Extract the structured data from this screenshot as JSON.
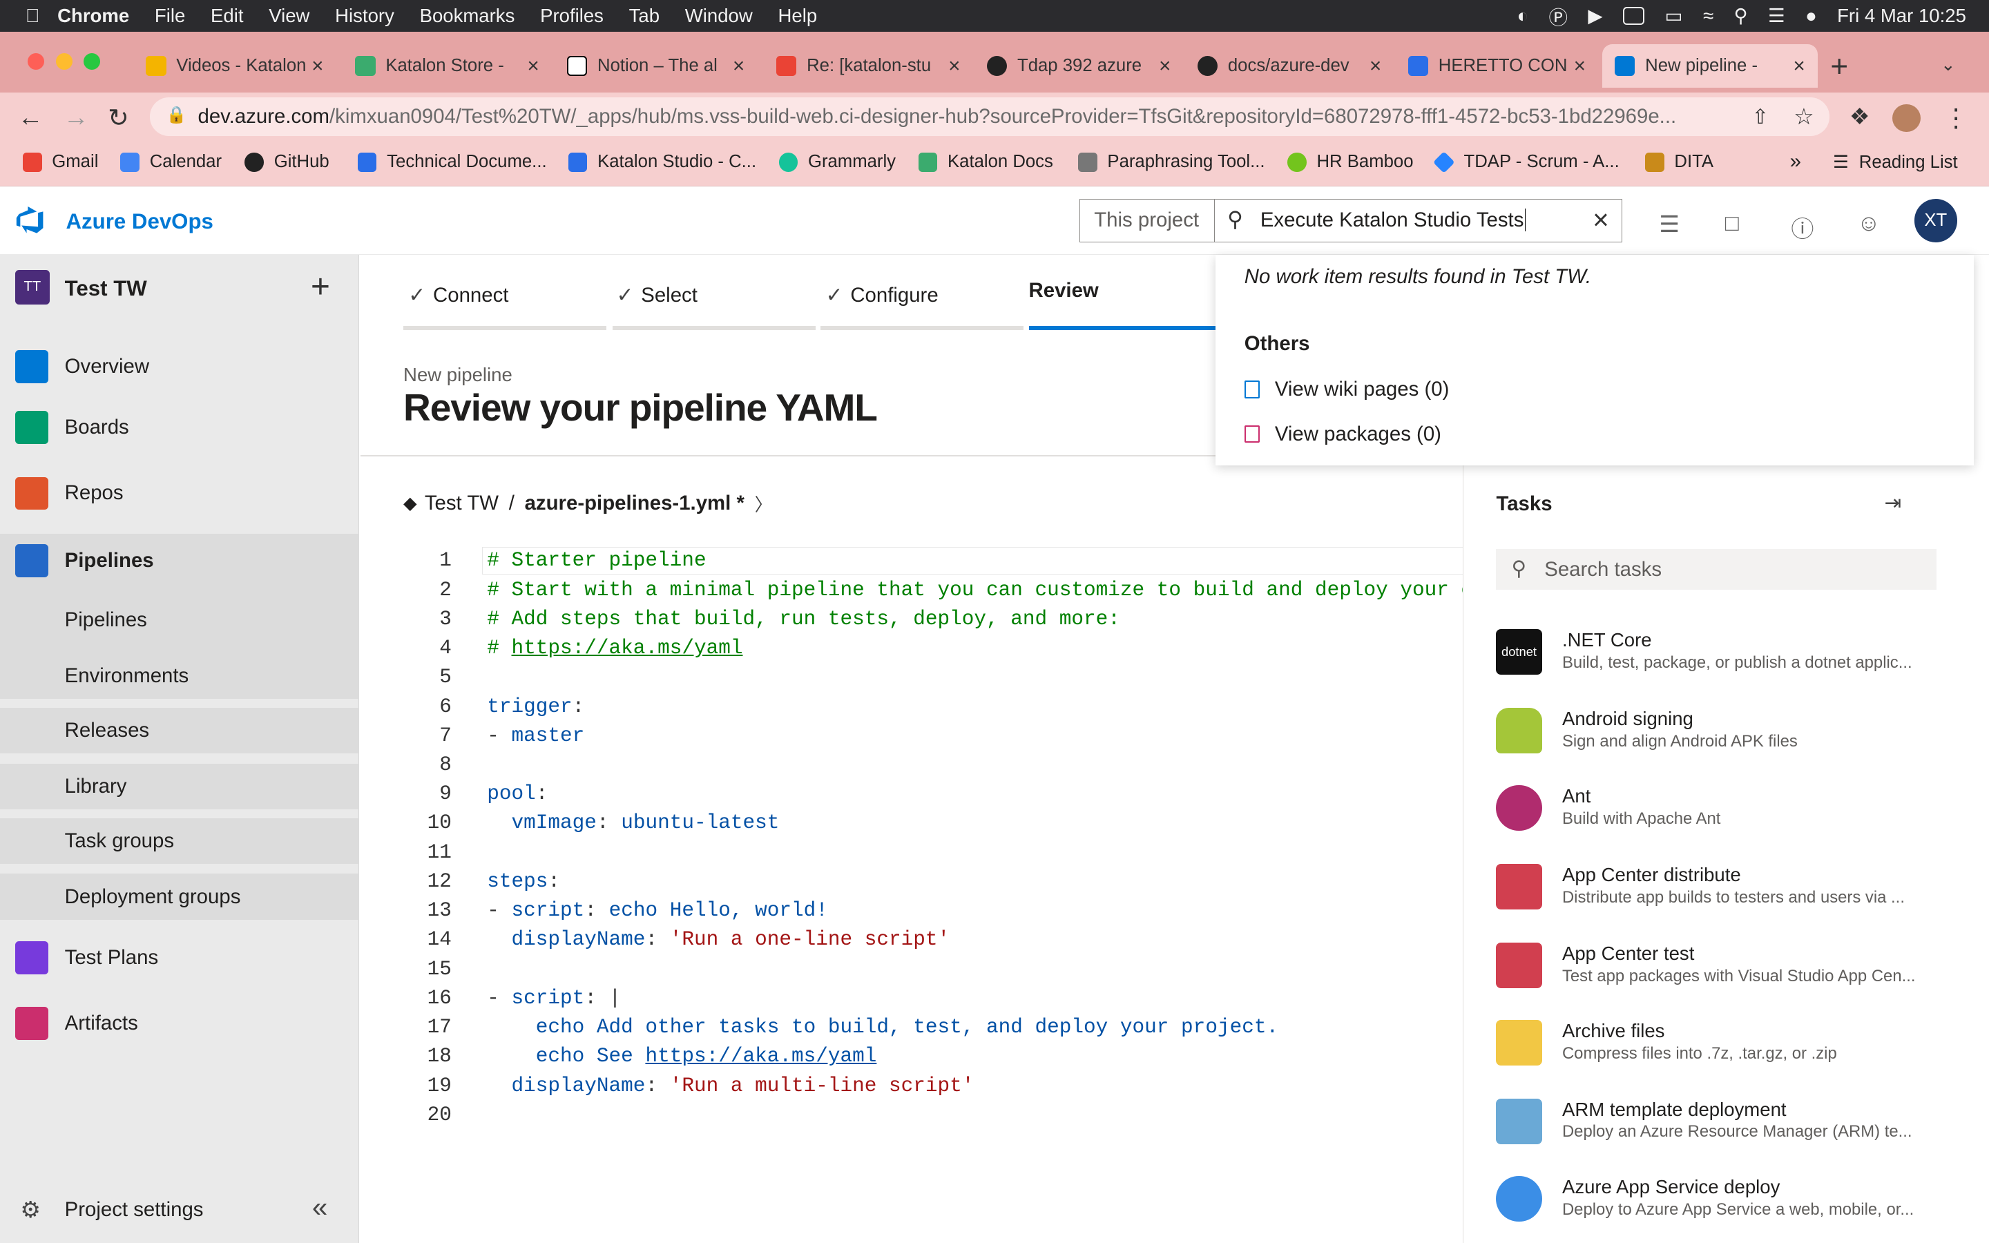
{
  "mac_menu": {
    "app": "Chrome",
    "items": [
      "File",
      "Edit",
      "View",
      "History",
      "Bookmarks",
      "Profiles",
      "Tab",
      "Window",
      "Help"
    ],
    "clock": "Fri 4 Mar  10:25"
  },
  "browser": {
    "tabs": [
      "Videos - Katalon",
      "Katalon Store -",
      "Notion – The al",
      "Re: [katalon-stu",
      "Tdap 392 azure",
      "docs/azure-dev",
      "HERETTO CON",
      "New pipeline - "
    ],
    "url_host": "dev.azure.com",
    "url_path": "/kimxuan0904/Test%20TW/_apps/hub/ms.vss-build-web.ci-designer-hub?sourceProvider=TfsGit&repositoryId=68072978-fff1-4572-bc53-1bd22969e...",
    "bookmarks": [
      "Gmail",
      "Calendar",
      "GitHub",
      "Technical Docume...",
      "Katalon Studio - C...",
      "Grammarly",
      "Katalon Docs",
      "Paraphrasing Tool...",
      "HR Bamboo",
      "TDAP - Scrum - A...",
      "DITA"
    ],
    "reading_list": "Reading List"
  },
  "header": {
    "brand": "Azure DevOps",
    "scope": "This project",
    "search_value": "Execute Katalon Studio Tests",
    "avatar": "XT"
  },
  "sidebar": {
    "project_initials": "TT",
    "project_name": "Test TW",
    "items": [
      "Overview",
      "Boards",
      "Repos",
      "Pipelines",
      "Pipelines",
      "Environments",
      "Releases",
      "Library",
      "Task groups",
      "Deployment groups",
      "Test Plans",
      "Artifacts"
    ],
    "settings": "Project settings"
  },
  "wizard": {
    "steps": [
      "Connect",
      "Select",
      "Configure",
      "Review"
    ],
    "subtitle": "New pipeline",
    "title": "Review your pipeline YAML"
  },
  "breadcrumb": {
    "repo": "Test TW",
    "sep": "/",
    "file": "azure-pipelines-1.yml *"
  },
  "editor": {
    "line_numbers": [
      "1",
      "2",
      "3",
      "4",
      "5",
      "6",
      "7",
      "8",
      "9",
      "10",
      "11",
      "12",
      "13",
      "14",
      "15",
      "16",
      "17",
      "18",
      "19",
      "20"
    ]
  },
  "search_dropdown": {
    "no_results": "No work item results found in Test TW.",
    "others": "Others",
    "wiki": "View wiki pages (0)",
    "packages": "View packages (0)"
  },
  "tasks": {
    "title": "Tasks",
    "search_placeholder": "Search tasks",
    "items": [
      {
        "name": ".NET Core",
        "desc": "Build, test, package, or publish a dotnet applic..."
      },
      {
        "name": "Android signing",
        "desc": "Sign and align Android APK files"
      },
      {
        "name": "Ant",
        "desc": "Build with Apache Ant"
      },
      {
        "name": "App Center distribute",
        "desc": "Distribute app builds to testers and users via ..."
      },
      {
        "name": "App Center test",
        "desc": "Test app packages with Visual Studio App Cen..."
      },
      {
        "name": "Archive files",
        "desc": "Compress files into .7z, .tar.gz, or .zip"
      },
      {
        "name": "ARM template deployment",
        "desc": "Deploy an Azure Resource Manager (ARM) te..."
      },
      {
        "name": "Azure App Service deploy",
        "desc": "Deploy to Azure App Service a web, mobile, or..."
      }
    ]
  }
}
